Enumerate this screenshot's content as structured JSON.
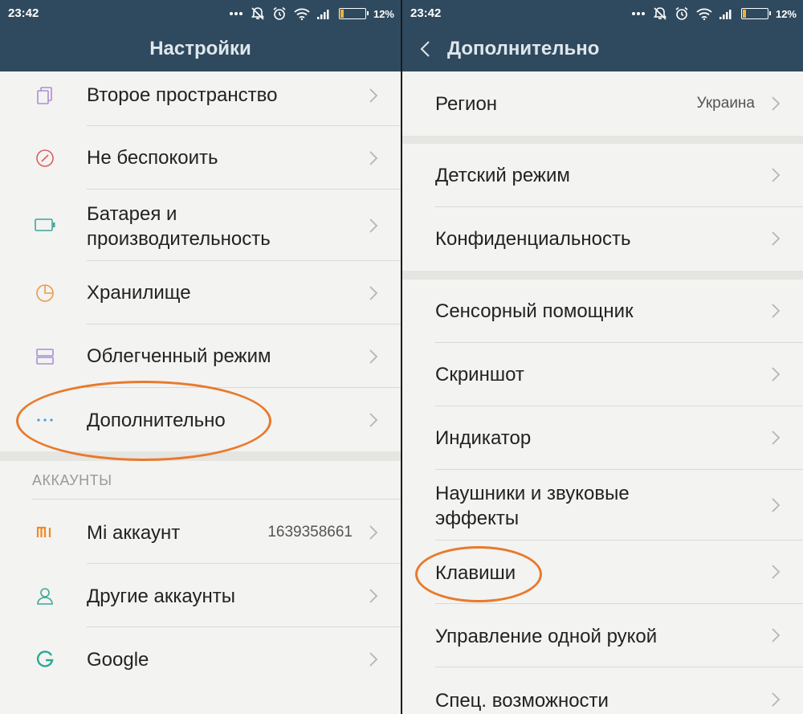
{
  "status_bar": {
    "time": "23:42",
    "battery_percent": "12%",
    "battery_level": 0.12
  },
  "left_screen": {
    "title": "Настройки",
    "items": [
      {
        "label": "Второе пространство",
        "icon": "second-space-icon"
      },
      {
        "label": "Не беспокоить",
        "icon": "do-not-disturb-icon"
      },
      {
        "label": "Батарея и производительность",
        "label_line1": "Батарея и",
        "label_line2": "производительность",
        "icon": "battery-icon"
      },
      {
        "label": "Хранилище",
        "icon": "storage-icon"
      },
      {
        "label": "Облегченный режим",
        "icon": "lite-mode-icon"
      },
      {
        "label": "Дополнительно",
        "icon": "more-dots-icon"
      }
    ],
    "accounts_header": "АККАУНТЫ",
    "accounts": [
      {
        "label": "Mi аккаунт",
        "value": "1639358661",
        "icon": "mi-logo-icon"
      },
      {
        "label": "Другие аккаунты",
        "icon": "person-icon"
      },
      {
        "label": "Google",
        "icon": "google-g-icon"
      }
    ]
  },
  "right_screen": {
    "title": "Дополнительно",
    "region": {
      "label": "Регион",
      "value": "Украина"
    },
    "group2": [
      {
        "label": "Детский режим"
      },
      {
        "label": "Конфиденциальность"
      }
    ],
    "group3": [
      {
        "label": "Сенсорный помощник"
      },
      {
        "label": "Скриншот"
      },
      {
        "label": "Индикатор"
      },
      {
        "label": "Наушники и звуковые эффекты",
        "label_line1": "Наушники и звуковые",
        "label_line2": "эффекты"
      },
      {
        "label": "Клавиши"
      },
      {
        "label": "Управление одной рукой"
      },
      {
        "label": "Спец. возможности"
      }
    ]
  },
  "colors": {
    "header_bg": "#2f4a5e",
    "page_bg": "#f3f3f1",
    "annotation": "#e87a2d",
    "battery_fill": "#f2b233"
  }
}
